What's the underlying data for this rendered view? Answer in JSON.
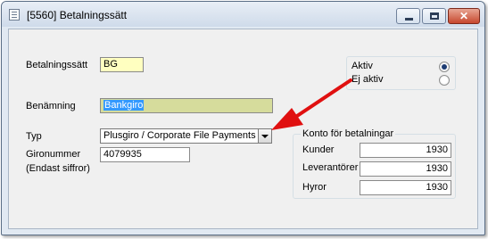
{
  "window": {
    "title": "[5560]  Betalningssätt",
    "icons": [
      "document-icon",
      "minimize-icon",
      "maximize-icon",
      "close-icon"
    ],
    "close_glyph": "✕"
  },
  "form": {
    "betalningssatt": {
      "label": "Betalningssätt",
      "value": "BG"
    },
    "benamning": {
      "label": "Benämning",
      "value": "Bankgiro"
    },
    "typ": {
      "label": "Typ",
      "selected": "Plusgiro / Corporate File Payments"
    },
    "gironummer": {
      "label": "Gironummer",
      "sublabel": "(Endast siffror)",
      "value": "4079935"
    }
  },
  "status": {
    "aktiv_label": "Aktiv",
    "ej_aktiv_label": "Ej aktiv",
    "selected": "Aktiv"
  },
  "konto": {
    "title": "Konto för betalningar",
    "rows": [
      {
        "label": "Kunder",
        "value": "1930"
      },
      {
        "label": "Leverantörer",
        "value": "1930"
      },
      {
        "label": "Hyror",
        "value": "1930"
      }
    ]
  },
  "colors": {
    "yellow_field": "#ffffc0",
    "olive_field": "#d6dc9c",
    "arrow": "#e01010",
    "selection": "#3399ff"
  }
}
